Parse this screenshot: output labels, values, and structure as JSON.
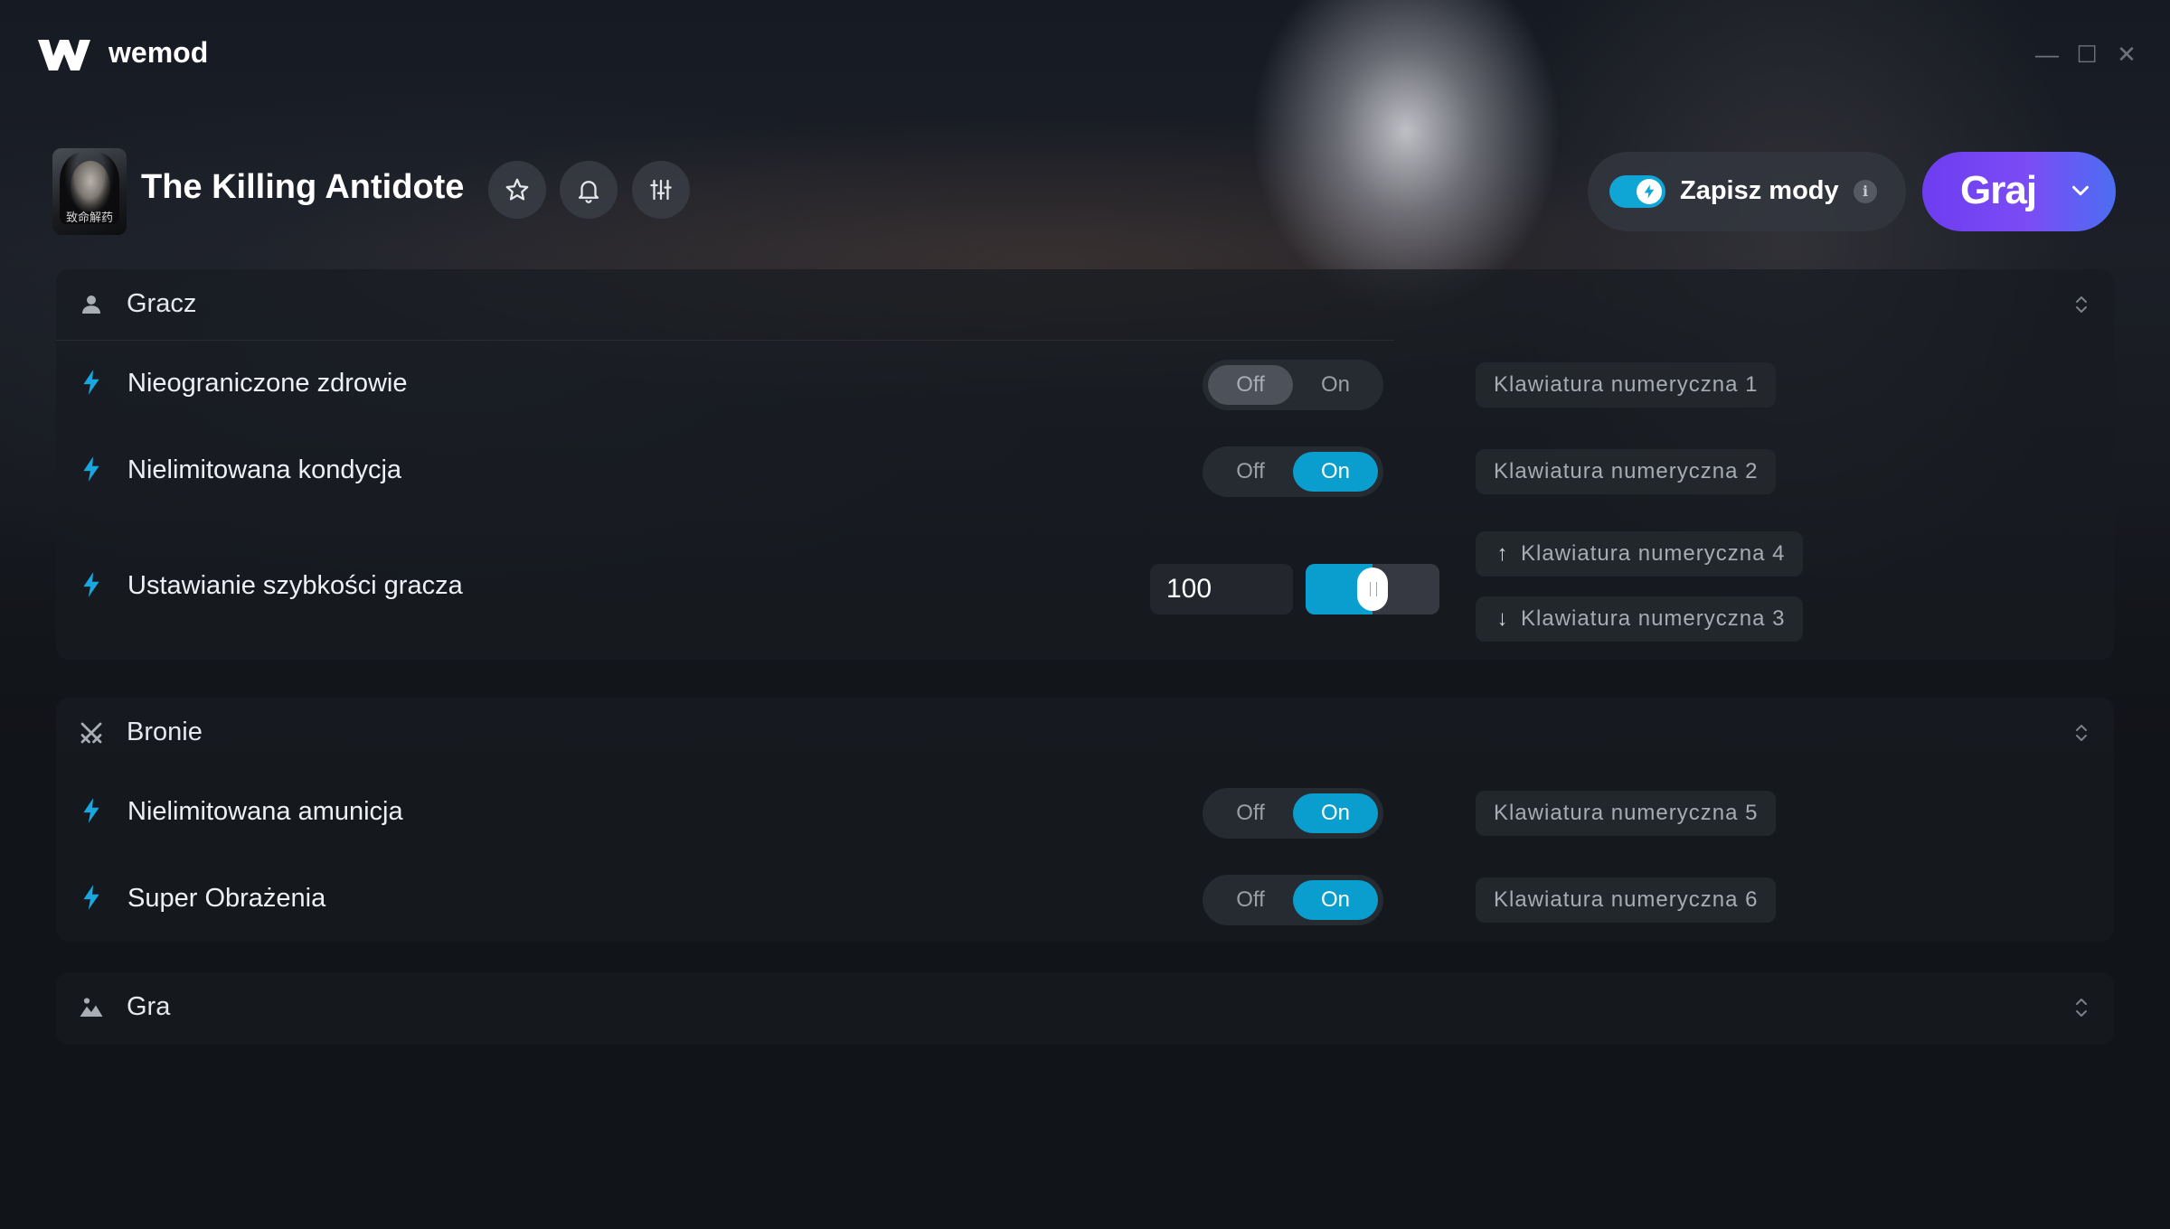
{
  "app": {
    "brand": "wemod"
  },
  "window_controls": {
    "minimize": "—",
    "maximize": "☐",
    "close": "✕"
  },
  "game": {
    "title": "The Killing Antidote",
    "cover_caption": "致命解药"
  },
  "header": {
    "save_mods_label": "Zapisz mody",
    "save_mods_enabled": true,
    "info_glyph": "i",
    "play_label": "Graj"
  },
  "sections": [
    {
      "title": "Gracz",
      "icon": "person-icon",
      "mods": [
        {
          "label": "Nieograniczone zdrowie",
          "type": "toggle",
          "off": "Off",
          "on": "On",
          "state": "off",
          "keys": [
            "Klawiatura numeryczna 1"
          ]
        },
        {
          "label": "Nielimitowana kondycja",
          "type": "toggle",
          "off": "Off",
          "on": "On",
          "state": "on",
          "keys": [
            "Klawiatura numeryczna 2"
          ]
        },
        {
          "label": "Ustawianie szybkości gracza",
          "type": "slider",
          "value": "100",
          "level": 0.5,
          "keys_up": "Klawiatura numeryczna 4",
          "keys_down": "Klawiatura numeryczna 3"
        }
      ]
    },
    {
      "title": "Bronie",
      "icon": "crossed-swords-icon",
      "mods": [
        {
          "label": "Nielimitowana amunicja",
          "type": "toggle",
          "off": "Off",
          "on": "On",
          "state": "on",
          "keys": [
            "Klawiatura numeryczna 5"
          ]
        },
        {
          "label": "Super Obrażenia",
          "type": "toggle",
          "off": "Off",
          "on": "On",
          "state": "on",
          "keys": [
            "Klawiatura numeryczna 6"
          ]
        }
      ]
    },
    {
      "title": "Gra",
      "icon": "landscape-icon",
      "mods": []
    }
  ],
  "colors": {
    "accent_blue": "#0a9ecf",
    "play_purple": "#6d3df0",
    "background": "#111418"
  }
}
